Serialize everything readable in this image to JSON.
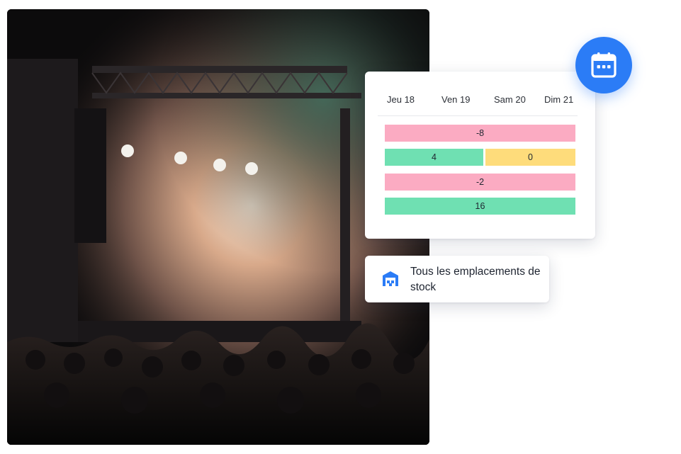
{
  "schedule": {
    "days": [
      "Jeu 18",
      "Ven 19",
      "Sam 20",
      "Dim 21"
    ],
    "rows": [
      {
        "cells": [
          {
            "value": "-8",
            "status": "negative",
            "span": "all"
          }
        ]
      },
      {
        "cells": [
          {
            "value": "4",
            "status": "positive",
            "span": "half"
          },
          {
            "value": "0",
            "status": "zero",
            "span": "half"
          }
        ]
      },
      {
        "cells": [
          {
            "value": "-2",
            "status": "negative",
            "span": "all"
          }
        ]
      },
      {
        "cells": [
          {
            "value": "16",
            "status": "positive",
            "span": "all"
          }
        ]
      }
    ],
    "colors": {
      "negative": "#fbabc2",
      "positive": "#6fe0b2",
      "zero": "#fedc7b"
    }
  },
  "calendar_badge": {
    "icon": "calendar-icon",
    "color": "#2b7cf6"
  },
  "stock": {
    "icon": "warehouse-icon",
    "label": "Tous les emplacements de stock"
  }
}
